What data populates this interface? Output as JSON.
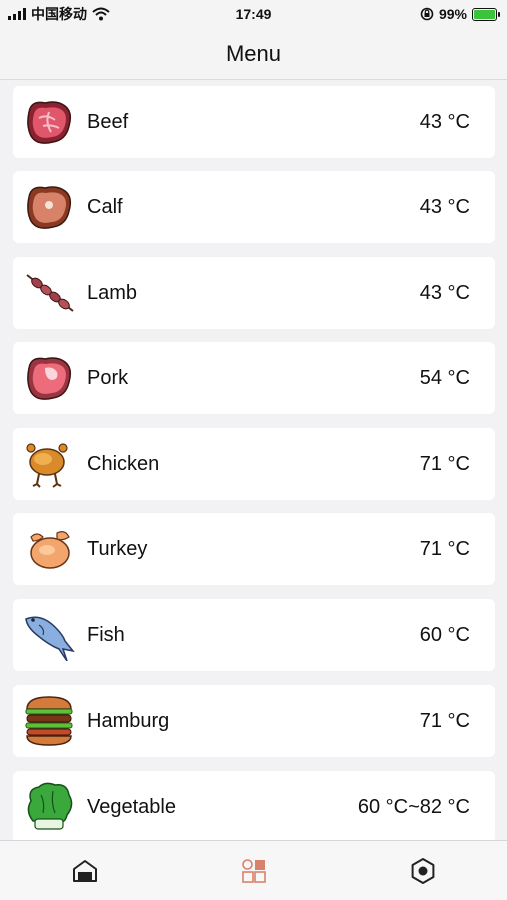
{
  "status_bar": {
    "carrier": "中国移动",
    "time": "17:49",
    "battery_percent": "99%",
    "battery_level": 0.99,
    "icons": [
      "signal-icon",
      "wifi-icon",
      "rotation-lock-icon",
      "battery-icon"
    ]
  },
  "header": {
    "title": "Menu"
  },
  "menu": {
    "items": [
      {
        "name": "Beef",
        "temp": "43 °C",
        "icon": "beef-steak-icon"
      },
      {
        "name": "Calf",
        "temp": "43 °C",
        "icon": "calf-steak-icon"
      },
      {
        "name": "Lamb",
        "temp": "43 °C",
        "icon": "lamb-skewer-icon"
      },
      {
        "name": "Pork",
        "temp": "54 °C",
        "icon": "pork-chop-icon"
      },
      {
        "name": "Chicken",
        "temp": "71 °C",
        "icon": "chicken-icon"
      },
      {
        "name": "Turkey",
        "temp": "71 °C",
        "icon": "turkey-icon"
      },
      {
        "name": "Fish",
        "temp": "60 °C",
        "icon": "fish-icon"
      },
      {
        "name": "Hamburg",
        "temp": "71 °C",
        "icon": "hamburger-icon"
      },
      {
        "name": "Vegetable",
        "temp": "60 °C~82 °C",
        "icon": "vegetable-icon"
      }
    ]
  },
  "tab_bar": {
    "tabs": [
      {
        "icon": "home-icon",
        "active": false
      },
      {
        "icon": "menu-grid-icon",
        "active": true
      },
      {
        "icon": "settings-icon",
        "active": false
      }
    ]
  },
  "colors": {
    "background": "#f2f2f4",
    "card": "#ffffff",
    "accent": "#d9826a",
    "battery": "#3bc43b"
  }
}
